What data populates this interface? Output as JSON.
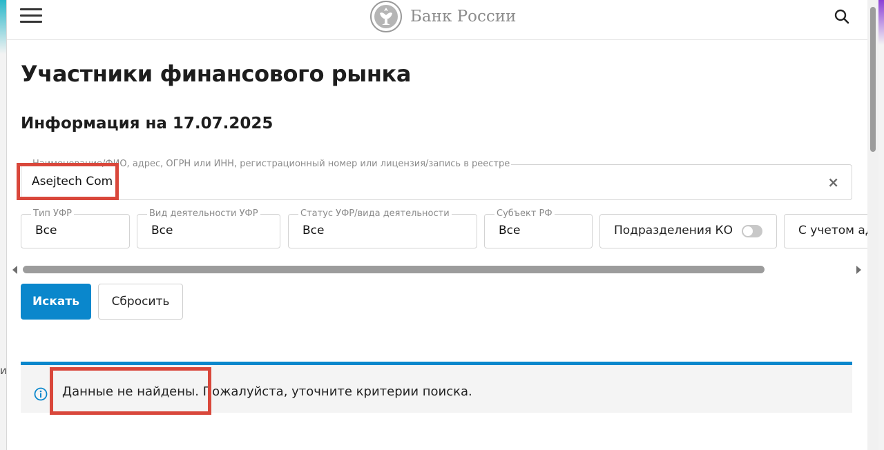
{
  "header": {
    "logo_text": "Банк России"
  },
  "page": {
    "title": "Участники финансового рынка",
    "subtitle": "Информация на 17.07.2025"
  },
  "search": {
    "label": "Наименование/ФИО, адрес, ОГРН или ИНН, регистрационный номер или лицензия/запись в реестре",
    "value": "Asejtech Com",
    "clear_symbol": "×"
  },
  "filters": [
    {
      "label": "Тип УФР",
      "value": "Все"
    },
    {
      "label": "Вид деятельности УФР",
      "value": "Все"
    },
    {
      "label": "Статус УФР/вида деятельности",
      "value": "Все"
    },
    {
      "label": "Субъект РФ",
      "value": "Все"
    },
    {
      "label": "Подразделения КО",
      "toggle": false
    },
    {
      "label": "С учетом ад"
    }
  ],
  "buttons": {
    "search": "Искать",
    "reset": "Сбросить"
  },
  "alert": {
    "message": "Данные не найдены. Пожалуйста, уточните критерии поиска."
  },
  "background": {
    "left_fragment": "и"
  },
  "colors": {
    "accent": "#0a87cc",
    "highlight": "#d9473b"
  },
  "icons": [
    "menu-icon",
    "bank-emblem-icon",
    "search-icon",
    "close-icon",
    "info-icon"
  ]
}
